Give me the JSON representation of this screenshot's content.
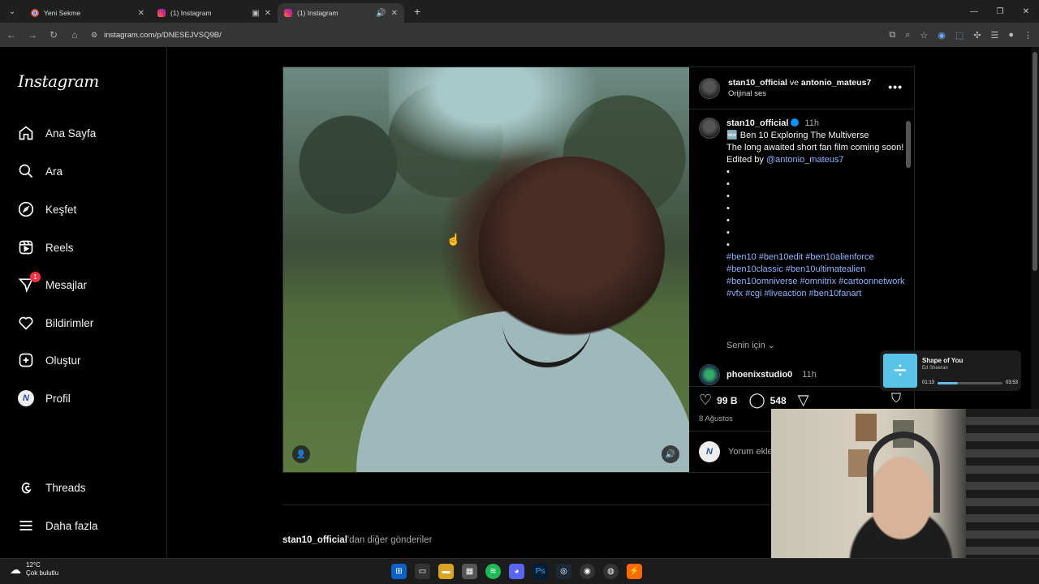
{
  "browser": {
    "tabs": [
      {
        "title": "Yeni Sekme",
        "icon": "chrome-icon",
        "active": false
      },
      {
        "title": "(1) Instagram",
        "icon": "instagram-icon",
        "active": false
      },
      {
        "title": "(1) Instagram",
        "icon": "instagram-icon",
        "active": true
      }
    ],
    "url": "instagram.com/p/DNESEJVSQ9B/"
  },
  "sidebar": {
    "logo": "Instagram",
    "items": [
      {
        "label": "Ana Sayfa",
        "icon": "home-icon"
      },
      {
        "label": "Ara",
        "icon": "search-icon"
      },
      {
        "label": "Keşfet",
        "icon": "compass-icon"
      },
      {
        "label": "Reels",
        "icon": "reels-icon"
      },
      {
        "label": "Mesajlar",
        "icon": "messenger-icon",
        "badge": "1"
      },
      {
        "label": "Bildirimler",
        "icon": "heart-icon"
      },
      {
        "label": "Oluştur",
        "icon": "plus-square-icon"
      },
      {
        "label": "Profil",
        "icon": "avatar"
      },
      {
        "label": "Threads",
        "icon": "threads-icon"
      },
      {
        "label": "Daha fazla",
        "icon": "menu-icon"
      }
    ]
  },
  "post": {
    "header": {
      "user": "stan10_official",
      "connector": "ve",
      "collab": "antonio_mateus7",
      "audio": "Orijinal ses"
    },
    "caption": {
      "user": "stan10_official",
      "time": "11h",
      "line1": "🆕 Ben 10 Exploring The Multiverse",
      "line2": "The long awaited short fan film coming soon!",
      "edited_prefix": "Edited by",
      "edited_user": "@antonio_mateus7",
      "dots": [
        "•",
        "•",
        "•",
        "•",
        "•",
        "•",
        "•"
      ],
      "tags": "#ben10 #ben10edit #ben10alienforce #ben10classic #ben10ultimatealien #ben10omniverse #omnitrix #cartoonnetwork #vfx #cgi #liveaction #ben10fanart"
    },
    "for_you": "Senin için",
    "comment": {
      "user": "phoenixstudio0",
      "time": "11h"
    },
    "likes": "99 B",
    "comments": "548",
    "date": "8 Ağustos",
    "comment_placeholder": "Yorum ekle..."
  },
  "more_posts": {
    "user": "stan10_official",
    "suffix": "'dan diğer gönderiler"
  },
  "music": {
    "title": "Shape of You",
    "artist": "Ed Sheeran",
    "elapsed": "01:13",
    "duration": "03:53",
    "progress": 0.31
  },
  "taskbar": {
    "temp": "12°C",
    "weather": "Çok bulutlu"
  },
  "colors": {
    "accent": "#0095f6",
    "link": "#8fb3ff",
    "badge": "#ff3040"
  }
}
